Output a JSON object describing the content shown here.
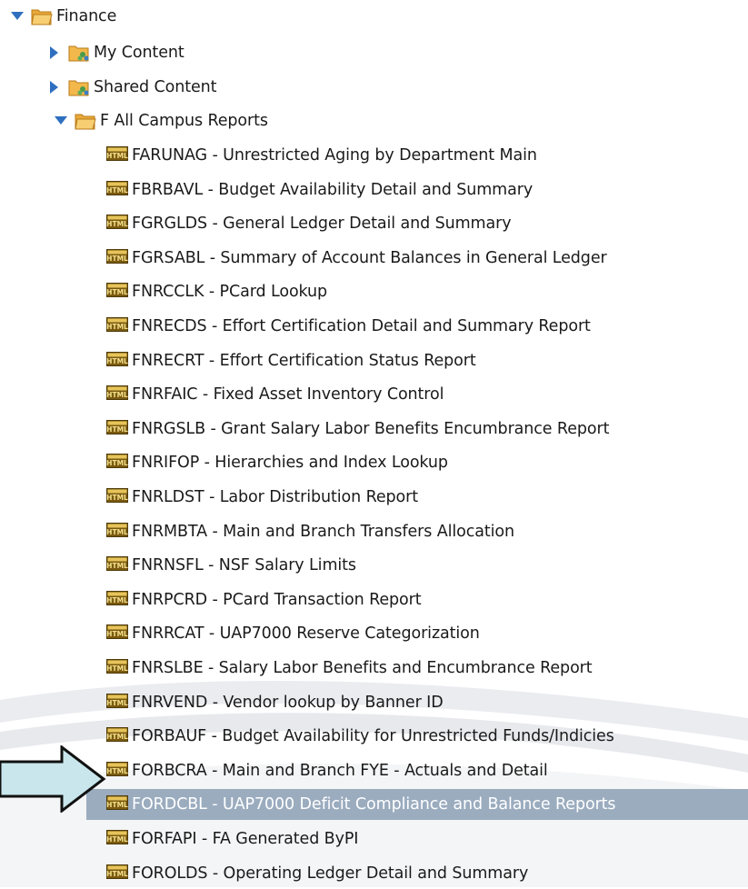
{
  "tree": {
    "root": {
      "label": "Finance",
      "expanded": true
    },
    "children": [
      {
        "label": "My Content",
        "expanded": false,
        "icon": "shared-folder-icon"
      },
      {
        "label": "Shared Content",
        "expanded": false,
        "icon": "shared-folder-icon"
      },
      {
        "label": "F All Campus Reports",
        "expanded": true,
        "icon": "folder-open-icon"
      }
    ],
    "reports": [
      "FARUNAG - Unrestricted Aging by Department Main",
      "FBRBAVL - Budget Availability Detail and Summary",
      "FGRGLDS - General Ledger Detail and Summary",
      "FGRSABL - Summary of Account Balances in General Ledger",
      "FNRCCLK - PCard Lookup",
      "FNRECDS - Effort Certification Detail and Summary Report",
      "FNRECRT - Effort Certification Status Report",
      "FNRFAIC - Fixed Asset Inventory Control",
      "FNRGSLB - Grant Salary Labor Benefits Encumbrance Report",
      "FNRIFOP - Hierarchies and Index Lookup",
      "FNRLDST - Labor Distribution Report",
      "FNRMBTA - Main and Branch Transfers Allocation",
      "FNRNSFL - NSF Salary Limits",
      "FNRPCRD - PCard Transaction Report",
      "FNRRCAT - UAP7000 Reserve Categorization",
      "FNRSLBE - Salary Labor Benefits and Encumbrance Report",
      "FNRVEND - Vendor lookup by Banner ID",
      "FORBAUF - Budget Availability for Unrestricted Funds/Indicies",
      "FORBCRA - Main and Branch FYE - Actuals and Detail",
      "FORDCBL - UAP7000 Deficit Compliance and Balance Reports",
      "FORFAPI - FA Generated ByPI",
      "FOROLDS - Operating Ledger Detail and Summary"
    ],
    "selected_index": 19,
    "report_icon_text": "HTML"
  },
  "colors": {
    "selected_bg": "#9bacbf",
    "arrow_fill": "#c8e6ec",
    "folder": "#f2b84b",
    "toggle": "#2f6fbf"
  }
}
